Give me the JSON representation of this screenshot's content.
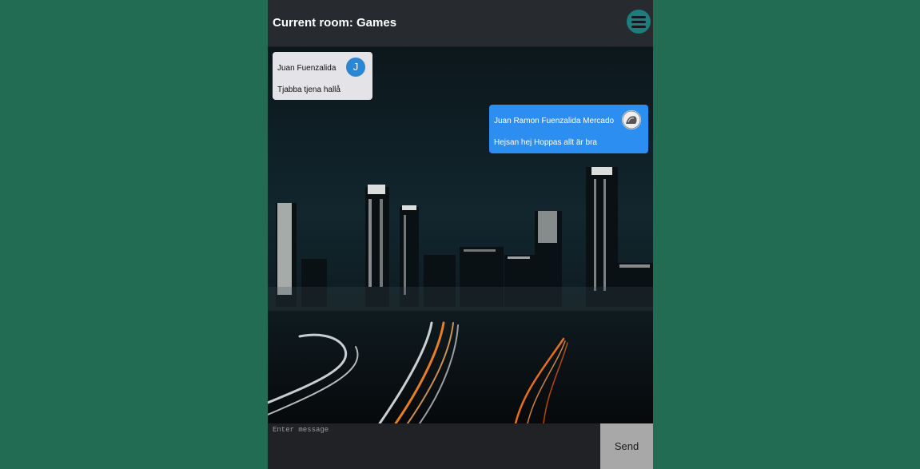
{
  "header": {
    "title": "Current room: Games",
    "menu_icon": "hamburger-menu-icon"
  },
  "messages": [
    {
      "sender": "Juan Fuenzalida",
      "avatar_initial": "J",
      "text": "Tjabba tjena hallå",
      "own": false
    },
    {
      "sender": "Juan Ramon Fuenzalida Mercado",
      "avatar_icon": "user-photo-icon",
      "text": "Hejsan hej Hoppas allt är bra",
      "own": true
    }
  ],
  "composer": {
    "placeholder": "Enter message",
    "value": "",
    "send_label": "Send"
  },
  "colors": {
    "page_background": "#216c53",
    "header_background": "#272a2f",
    "menu_button": "#1d7d7d",
    "own_message": "#2c8ef0",
    "other_message": "#e4e3e8",
    "send_button": "#a8a8a8"
  }
}
